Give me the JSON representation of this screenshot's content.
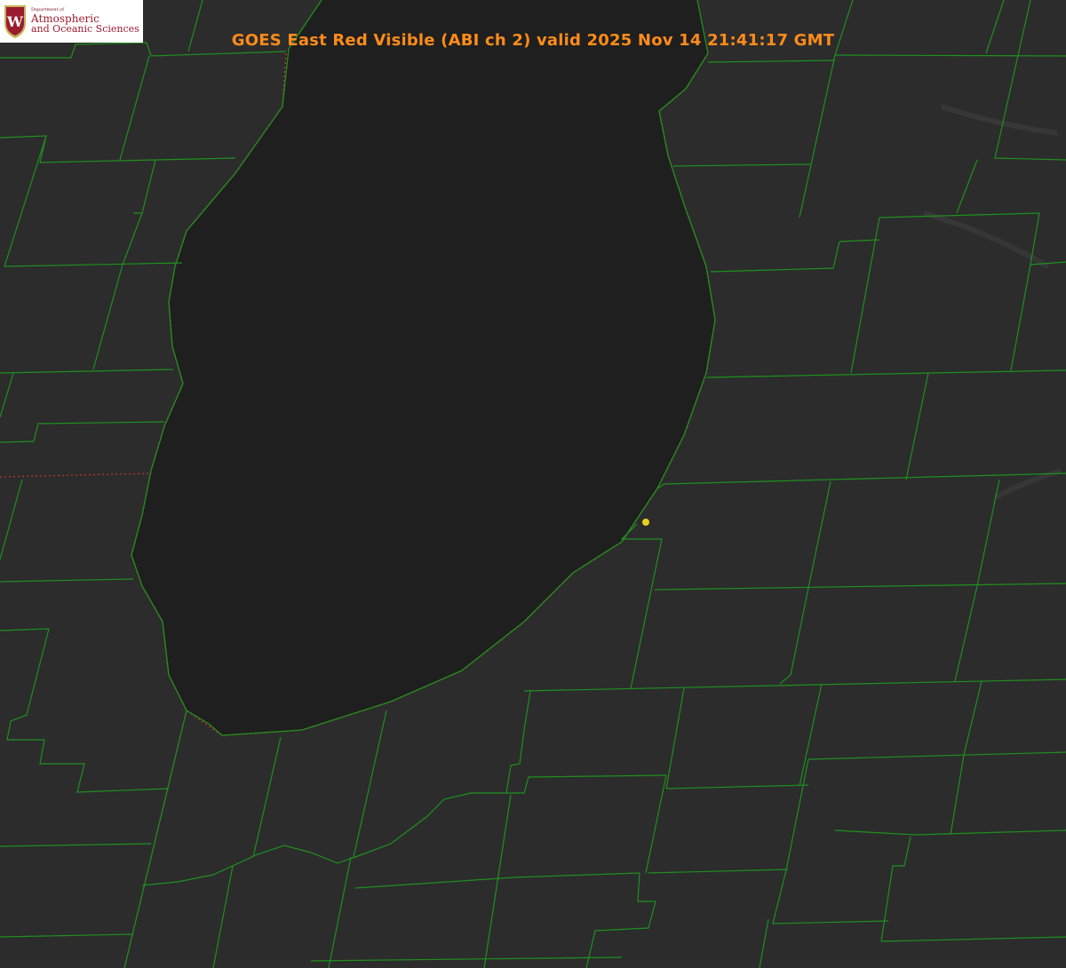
{
  "title": "GOES East Red Visible (ABI ch 2) valid 2025 Nov 14 21:41:17 GMT",
  "logo": {
    "department": "Department of",
    "line1": "Atmospheric",
    "line2": "and Oceanic Sciences",
    "crest_letter": "W"
  },
  "colors": {
    "land": "#2c2c2c",
    "lake": "#1f1f1f",
    "county_lines": "#1f8f1f",
    "shoreline_dotted": "#c0392b",
    "marker": "#e6d21e",
    "title": "#ff8c1a",
    "logo_text": "#9b1b30"
  },
  "icons": {
    "crest": "uw-crest-icon",
    "station_marker": "station-dot-icon"
  }
}
